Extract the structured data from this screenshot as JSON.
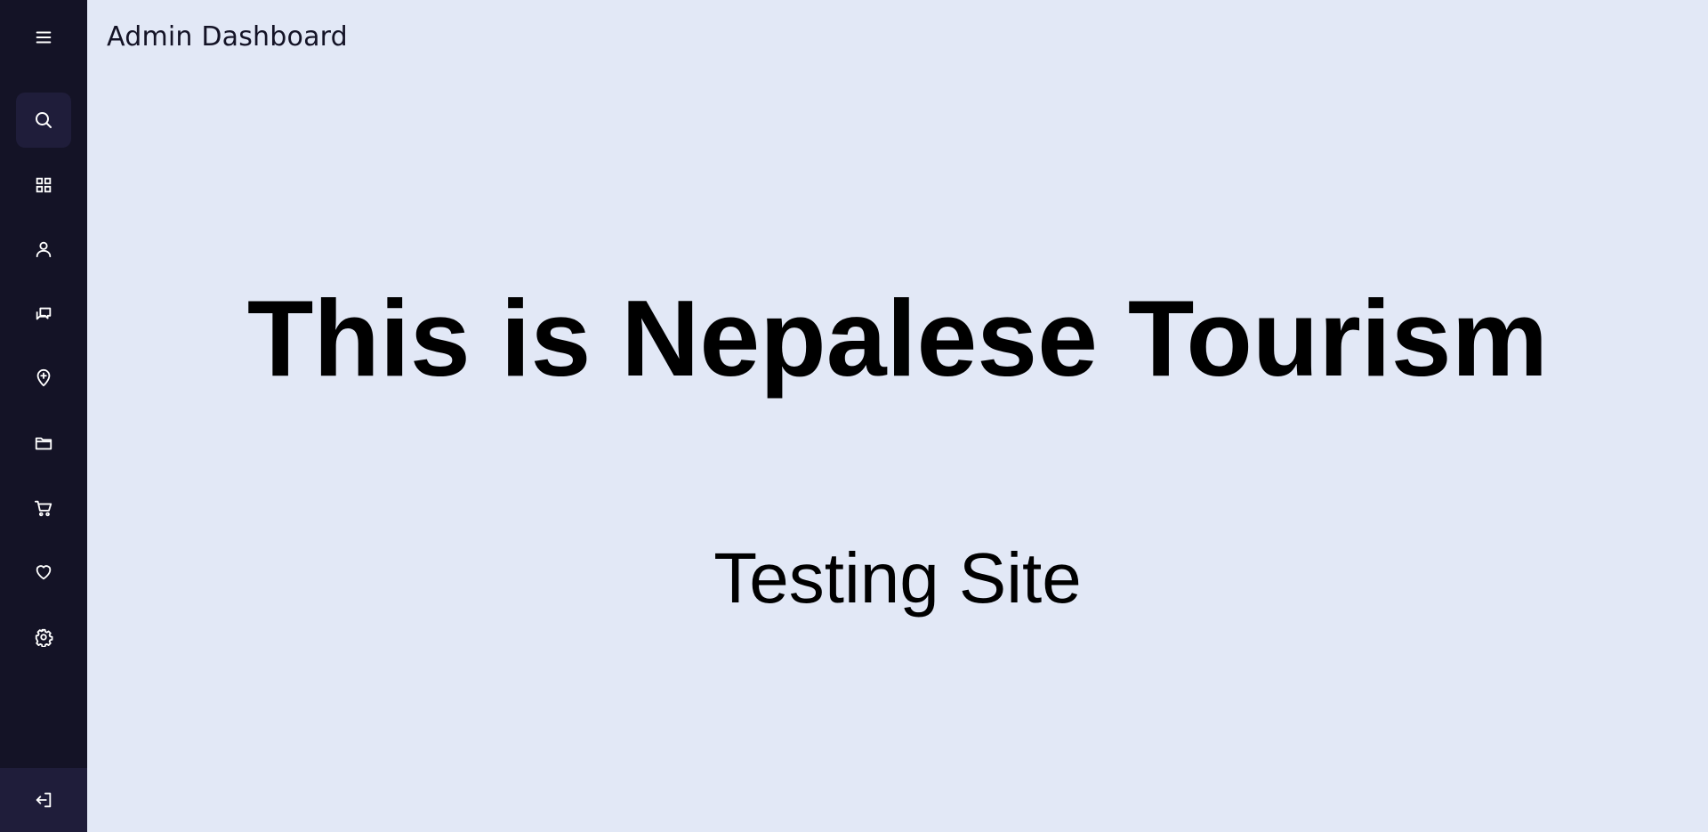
{
  "header": {
    "title": "Admin Dashboard"
  },
  "sidebar": {
    "menu_icon": "menu-icon",
    "items": [
      {
        "icon": "search-icon",
        "active": true
      },
      {
        "icon": "grid-icon",
        "active": false
      },
      {
        "icon": "user-icon",
        "active": false
      },
      {
        "icon": "chat-icon",
        "active": false
      },
      {
        "icon": "location-pin-icon",
        "active": false
      },
      {
        "icon": "folder-icon",
        "active": false
      },
      {
        "icon": "cart-icon",
        "active": false
      },
      {
        "icon": "heart-icon",
        "active": false
      },
      {
        "icon": "gear-icon",
        "active": false
      }
    ],
    "logout_icon": "logout-icon"
  },
  "main": {
    "headline": "This is Nepalese Tourism",
    "subheadline": "Testing Site"
  },
  "colors": {
    "sidebar_bg": "#141326",
    "sidebar_active_bg": "#1f1d3a",
    "page_bg": "#e2e8f6",
    "text": "#000000",
    "icon": "#ffffff"
  }
}
